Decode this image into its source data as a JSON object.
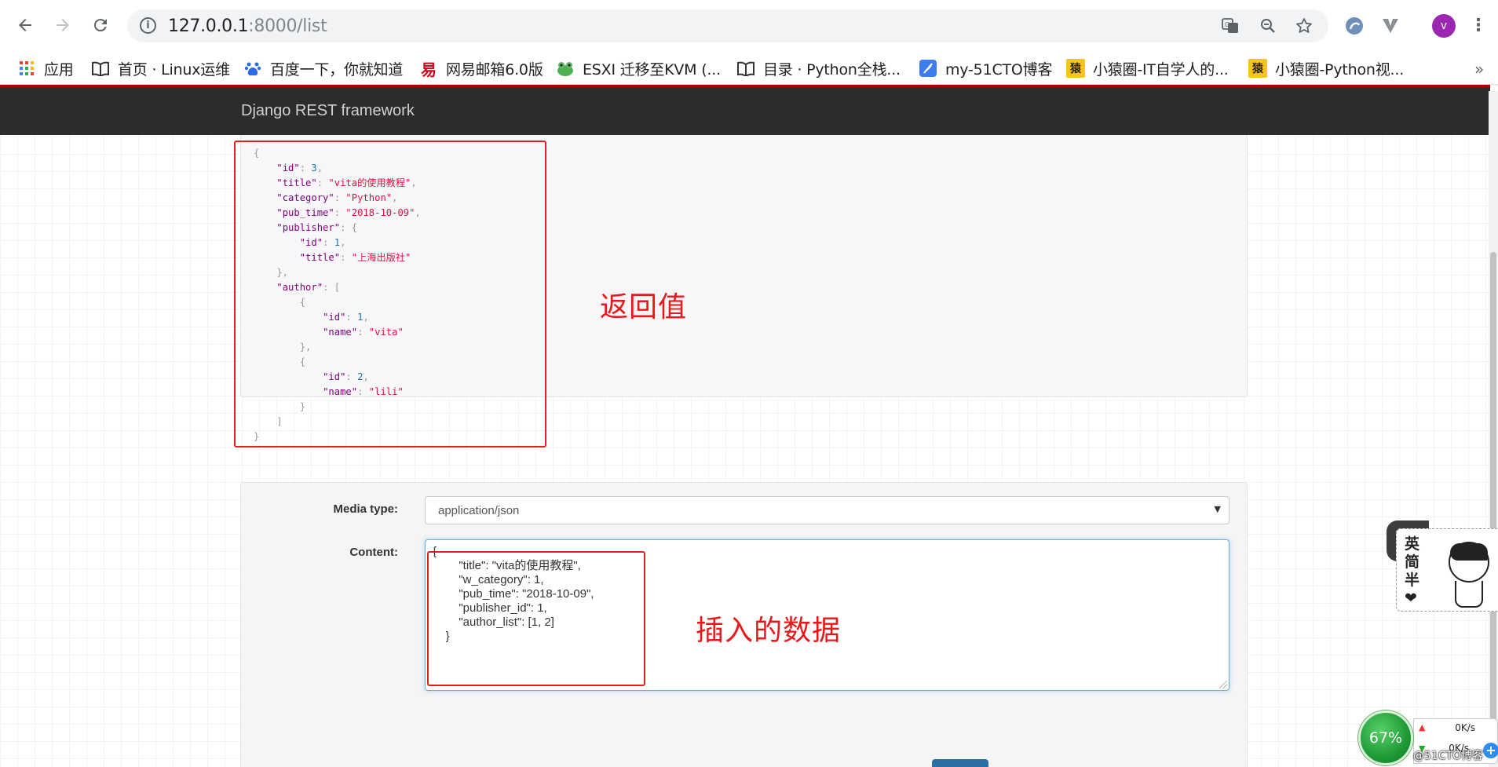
{
  "browser": {
    "url_host": "127.0.0.1",
    "url_path": ":8000/list",
    "avatar_letter": "v",
    "bookmarks": [
      {
        "label": "应用",
        "icon": "apps-grid-icon"
      },
      {
        "label": "首页 · Linux运维",
        "icon": "book-icon"
      },
      {
        "label": "百度一下，你就知道",
        "icon": "baidu-paw-icon"
      },
      {
        "label": "网易邮箱6.0版",
        "icon": "netease-icon"
      },
      {
        "label": "ESXI 迁移至KVM (...",
        "icon": "frog-icon"
      },
      {
        "label": "目录 · Python全栈...",
        "icon": "book-icon"
      },
      {
        "label": "my-51CTO博客",
        "icon": "feather-icon"
      },
      {
        "label": "小猿圈-IT自学人的...",
        "icon": "yuan-icon"
      },
      {
        "label": "小猿圈-Python视...",
        "icon": "yuan-icon"
      }
    ],
    "more": "»"
  },
  "drf": {
    "brand": "Django REST framework"
  },
  "response": {
    "lines": [
      "{",
      "    \"id\": 3,",
      "    \"title\": \"vita的使用教程\",",
      "    \"category\": \"Python\",",
      "    \"pub_time\": \"2018-10-09\",",
      "    \"publisher\": {",
      "        \"id\": 1,",
      "        \"title\": \"上海出版社\"",
      "    },",
      "    \"author\": [",
      "        {",
      "            \"id\": 1,",
      "            \"name\": \"vita\"",
      "        },",
      "        {",
      "            \"id\": 2,",
      "            \"name\": \"lili\"",
      "        }",
      "    ]",
      "}"
    ]
  },
  "form": {
    "media_type_label": "Media type:",
    "media_type_value": "application/json",
    "content_label": "Content:",
    "content_lines": [
      "{",
      "        \"title\": \"vita的使用教程\",",
      "        \"w_category\": 1,",
      "        \"pub_time\": \"2018-10-09\",",
      "        \"publisher_id\": 1,",
      "        \"author_list\": [1, 2]",
      "    }"
    ]
  },
  "annotations": {
    "return_value": "返回值",
    "inserted_data": "插入的数据"
  },
  "widgets": {
    "ime_chars": "英简半❤",
    "cpu_percent": "67%",
    "upload_speed": "0K/s",
    "download_speed": "0K/s",
    "watermark": "@51CTO博客"
  },
  "colors": {
    "annotation_red": "#e02020",
    "drf_header": "#2c2c2c",
    "drf_accent": "#a30000",
    "json_key": "#800080",
    "json_string": "#d14",
    "json_number": "#1d75b3"
  }
}
